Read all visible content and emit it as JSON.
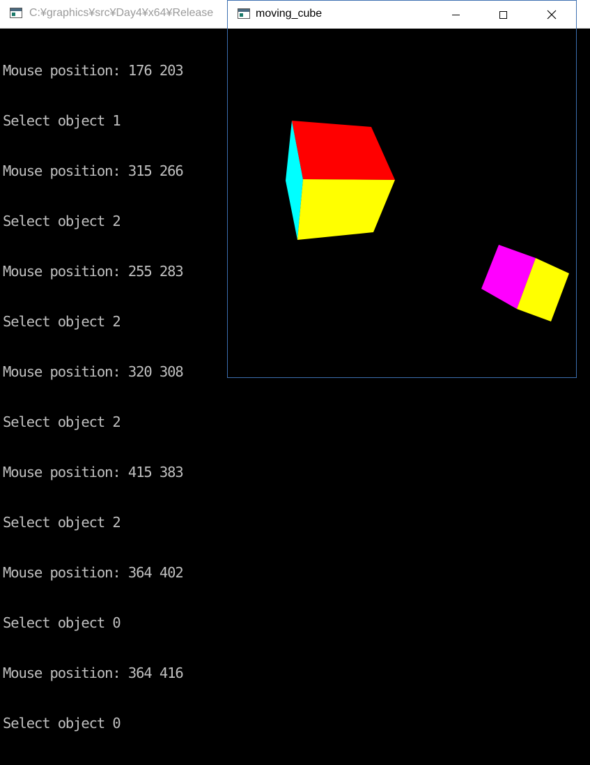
{
  "console": {
    "title": "C:¥graphics¥src¥Day4¥x64¥Release",
    "lines": [
      "Mouse position: 176 203",
      "Select object 1",
      "Mouse position: 315 266",
      "Select object 2",
      "Mouse position: 255 283",
      "Select object 2",
      "Mouse position: 320 308",
      "Select object 2",
      "Mouse position: 415 383",
      "Select object 2",
      "Mouse position: 364 402",
      "Select object 0",
      "Mouse position: 364 416",
      "Select object 0"
    ]
  },
  "gl_window": {
    "title": "moving_cube",
    "buttons": {
      "minimize": "minimize-icon",
      "maximize": "maximize-icon",
      "close": "close-icon"
    }
  },
  "scene": {
    "background": "#000000",
    "face_colors": {
      "red": "#ff0000",
      "yellow": "#ffff00",
      "cyan": "#00ffff",
      "magenta": "#ff00ff"
    }
  }
}
